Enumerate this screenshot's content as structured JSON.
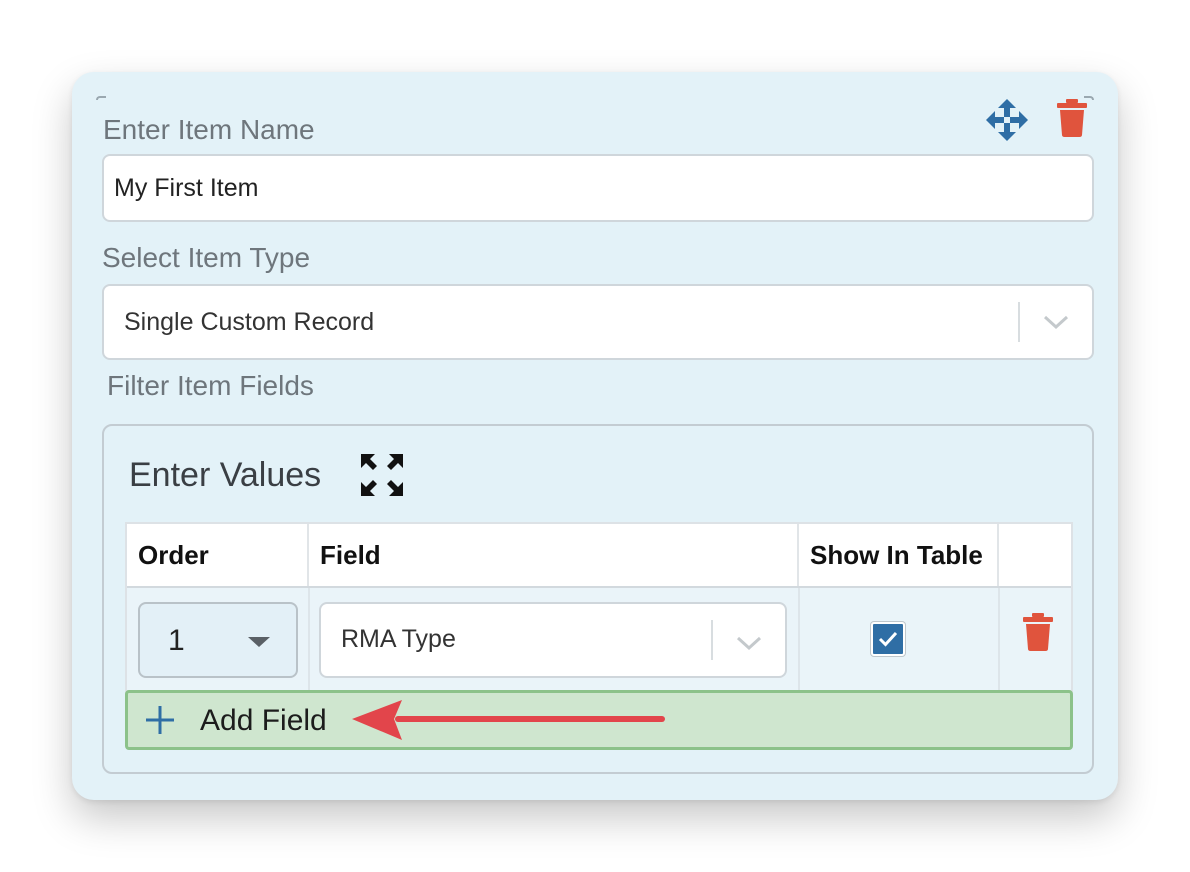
{
  "item_name": {
    "label": "Enter Item Name",
    "value": "My First Item"
  },
  "item_type": {
    "label": "Select Item Type",
    "selected": "Single Custom Record"
  },
  "filter": {
    "label": "Filter Item Fields",
    "values_title": "Enter Values",
    "columns": [
      "Order",
      "Field",
      "Show In Table",
      ""
    ],
    "rows": [
      {
        "order": "1",
        "field": "RMA Type",
        "show_in_table": true
      }
    ],
    "add_field_label": "Add Field"
  },
  "colors": {
    "card_bg": "#e3f2f8",
    "delete_red": "#e0543d",
    "move_blue": "#2f6ea5",
    "add_field_bg": "#cfe6cf",
    "add_field_border": "#8cc28a",
    "annotation_arrow": "#e2454b"
  },
  "icons": {
    "move": "move-arrows-icon",
    "delete": "trash-icon",
    "expand": "expand-icon",
    "add": "plus-icon",
    "dropdown": "chevron-down-icon",
    "checkbox": "checkmark-icon"
  }
}
